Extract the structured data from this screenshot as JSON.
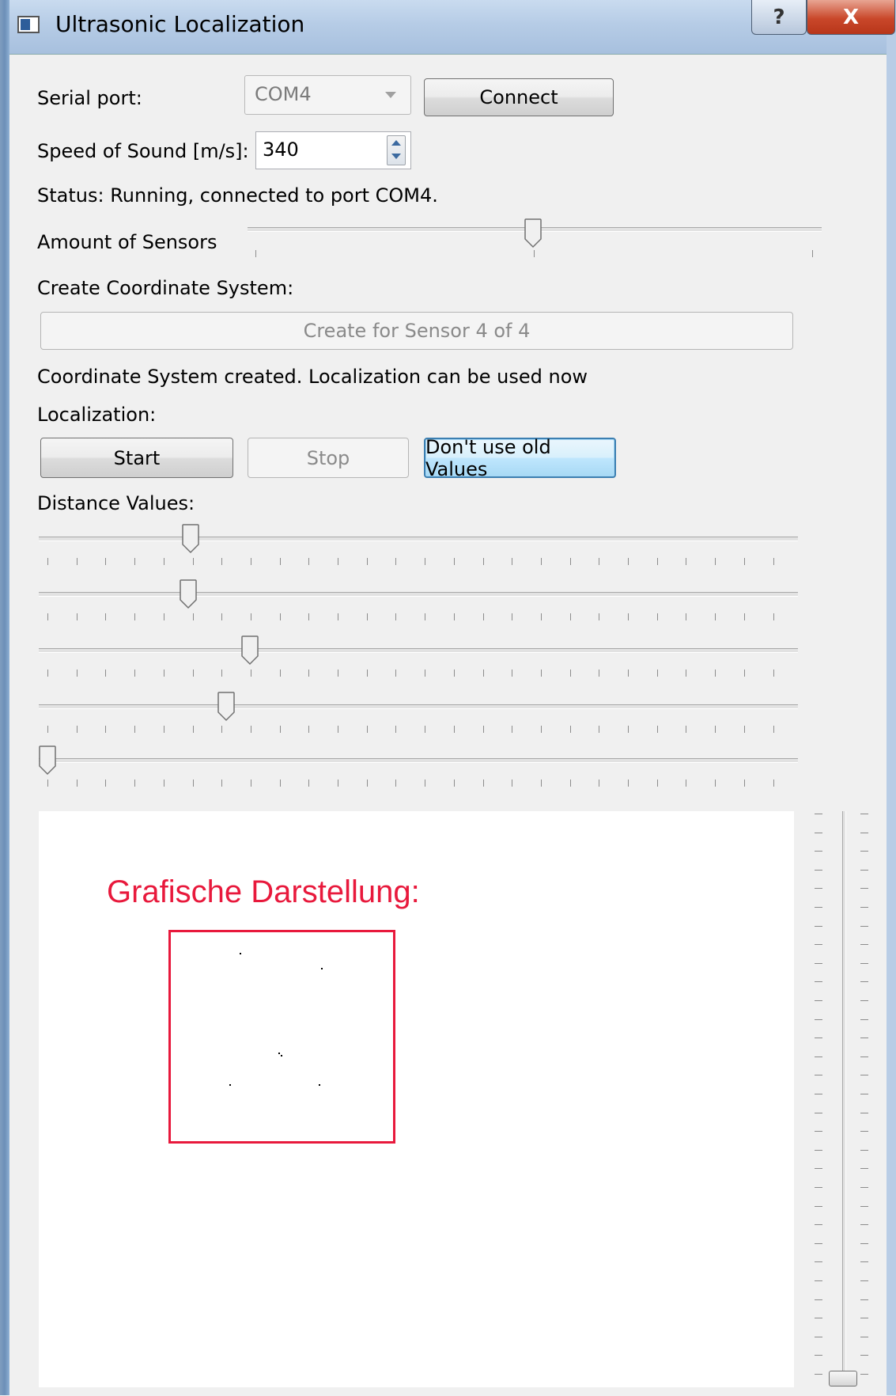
{
  "window": {
    "title": "Ultrasonic Localization",
    "help_glyph": "?",
    "close_glyph": "X"
  },
  "serial": {
    "label": "Serial port:",
    "port": "COM4",
    "connect_label": "Connect"
  },
  "speed": {
    "label": "Speed of Sound [m/s]:",
    "value": "340"
  },
  "status_text": "Status: Running, connected to port COM4.",
  "sensors": {
    "label": "Amount of Sensors"
  },
  "coordinate": {
    "label": "Create Coordinate System:",
    "button_label": "Create for Sensor 4 of 4",
    "message": "Coordinate System created. Localization can be used now"
  },
  "localization": {
    "label": "Localization:",
    "start_label": "Start",
    "stop_label": "Stop",
    "old_values_label": "Don't use old Values"
  },
  "distance": {
    "label": "Distance Values:"
  },
  "canvas": {
    "title": "Grafische Darstellung:"
  },
  "colors": {
    "canvas_accent": "#e8193c",
    "focus_border": "#3c7fb1",
    "window_frame": "#b6cce6"
  }
}
